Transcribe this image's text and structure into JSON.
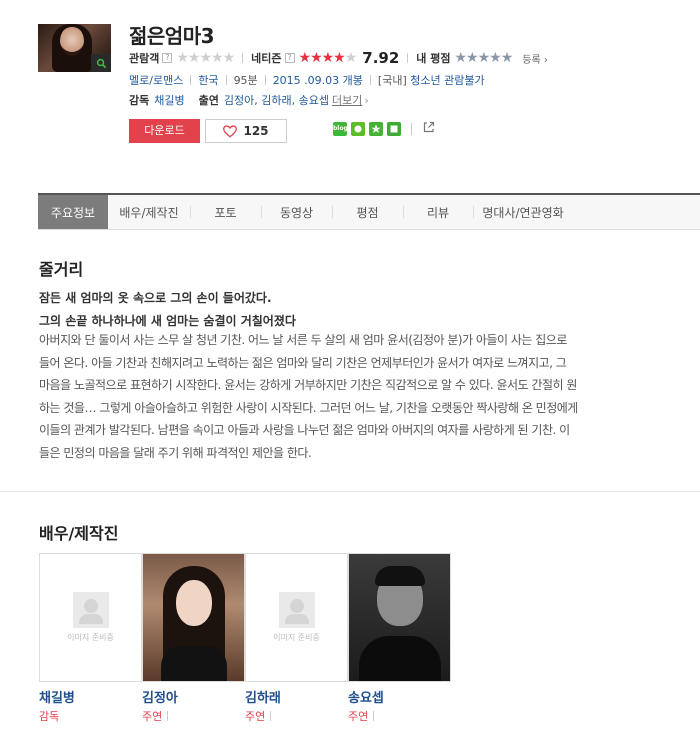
{
  "movie": {
    "title": "젊은엄마3",
    "poster_zoom_icon": "magnifier-icon"
  },
  "ratings": {
    "audience_label": "관람객",
    "audience_stars": 0,
    "netizen_label": "네티즌",
    "netizen_stars": 4,
    "netizen_score": "7.92",
    "my_label": "내 평점",
    "register_label": "등록 ›"
  },
  "info": {
    "genre": "멜로/로맨스",
    "country": "한국",
    "runtime": "95분",
    "release": "2015 .09.03 개봉",
    "grade_prefix": "[국내]",
    "grade": "청소년 관람불가"
  },
  "crew": {
    "director_label": "감독",
    "director": "채길병",
    "cast_label": "출연",
    "cast": "김정아, 김하래, 송요셉",
    "more": "더보기",
    "more_arrow": "›"
  },
  "actions": {
    "download": "다운로드",
    "like_count": "125",
    "share_icons": [
      "blog-icon",
      "kakao-icon",
      "star-icon",
      "square-icon"
    ],
    "export_icon": "share-export-icon"
  },
  "tabs": [
    "주요정보",
    "배우/제작진",
    "포토",
    "동영상",
    "평점",
    "리뷰",
    "명대사/연관영화"
  ],
  "synopsis": {
    "heading": "줄거리",
    "tagline1": "잠든 새 엄마의 옷 속으로 그의 손이 들어갔다.",
    "tagline2": "그의 손끝 하나하나에 새 엄마는 숨결이 거칠어졌다",
    "lines": [
      "아버지와 단 둘이서 사는 스무 살 청년 기찬. 어느 날 서른 두 살의 새 엄마 윤서(김정아 분)가 아들이 사는 집으로",
      "들어 온다. 아들 기찬과 친해지려고 노력하는 젊은 엄마와 달리 기찬은 언제부터인가 윤서가 여자로 느껴지고, 그",
      "마음을 노골적으로 표현하기 시작한다. 윤서는 강하게 거부하지만 기찬은 직감적으로 알 수 있다. 윤서도 간절히 원",
      "하는 것을… 그렇게 아슬아슬하고 위험한 사랑이 시작된다. 그러던 어느 날, 기찬을 오랫동안 짝사랑해 온 민정에게",
      "이들의 관계가 발각된다. 남편을 속이고 아들과 사랑을 나누던 젊은 엄마와 아버지의 여자를 사랑하게 된 기찬. 이",
      "들은 민정의 마음을 달래 주기 위해 파격적인 제안을 한다."
    ]
  },
  "cast_section": {
    "heading": "배우/제작진",
    "placeholder_text": "이미지 준비중",
    "members": [
      {
        "name": "채길병",
        "role": "감독",
        "photo": "placeholder"
      },
      {
        "name": "김정아",
        "role": "주연",
        "photo": "woman"
      },
      {
        "name": "김하래",
        "role": "주연",
        "photo": "placeholder"
      },
      {
        "name": "송요셉",
        "role": "주연",
        "photo": "man"
      }
    ]
  }
}
